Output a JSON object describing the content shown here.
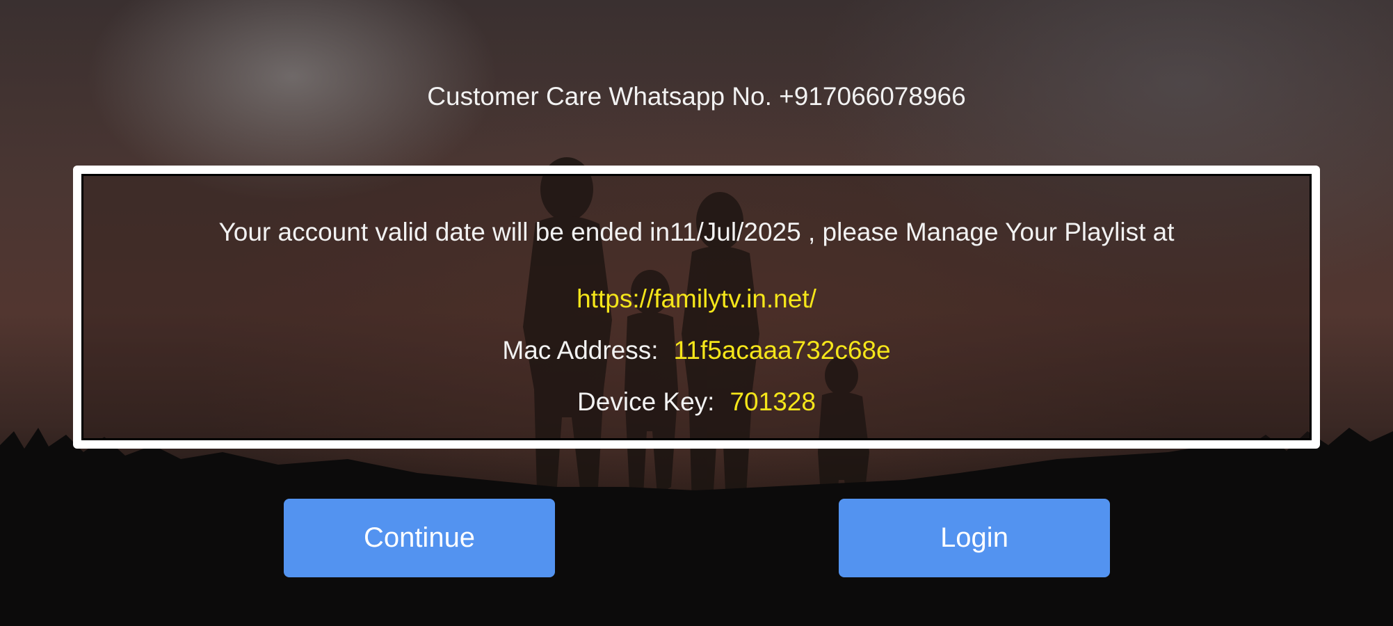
{
  "customer_care": {
    "text": "Customer Care Whatsapp No. +917066078966"
  },
  "notice": {
    "message": "Your account valid date will be ended in11/Jul/2025 , please Manage Your Playlist at",
    "url": "https://familytv.in.net/",
    "mac_label": "Mac Address:",
    "mac_value": "11f5acaaa732c68e",
    "device_key_label": "Device Key:",
    "device_key_value": "701328"
  },
  "buttons": {
    "continue_label": "Continue",
    "login_label": "Login"
  },
  "colors": {
    "button": "#5393f0",
    "highlight": "#f5e61a",
    "frame": "#ffffff"
  }
}
